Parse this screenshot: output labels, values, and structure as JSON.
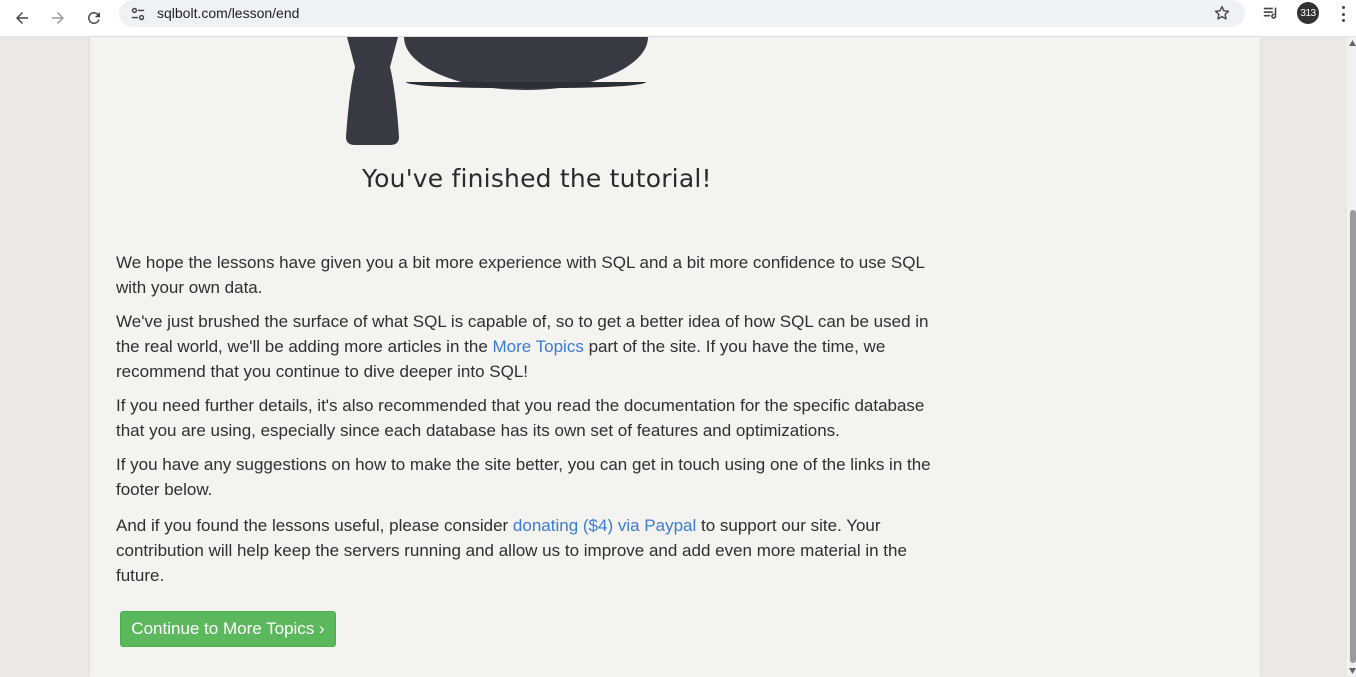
{
  "browser": {
    "url": "sqlbolt.com/lesson/end",
    "profile_badge": "313",
    "icons": [
      "back-icon",
      "forward-icon",
      "reload-icon",
      "site-info-icon",
      "star-icon",
      "reading-list-icon",
      "menu-icon"
    ]
  },
  "page": {
    "title": "You've finished the tutorial!",
    "p1": "We hope the lessons have given you a bit more experience with SQL and a bit more confidence to use SQL with your own data.",
    "p2_before": "We've just brushed the surface of what SQL is capable of, so to get a better idea of how SQL can be used in the real world, we'll be adding more articles in the ",
    "p2_link": "More Topics",
    "p2_after": " part of the site. If you have the time, we recommend that you continue to dive deeper into SQL!",
    "p3": "If you need further details, it's also recommended that you read the documentation for the specific database that you are using, especially since each database has its own set of features and optimizations.",
    "p4": "If you have any suggestions on how to make the site better, you can get in touch using one of the links in the footer below.",
    "p5_before": "And if you found the lessons useful, please consider ",
    "p5_link": "donating ($4) via Paypal",
    "p5_after": " to support our site. Your contribution will help keep the servers running and allow us to improve and add even more material in the future.",
    "cta_label": "Continue to More Topics ›"
  },
  "colors": {
    "link": "#3a7bd5",
    "button": "#5cb85c",
    "page_bg": "#f4f3f0",
    "outer_bg": "#ece8e4"
  }
}
